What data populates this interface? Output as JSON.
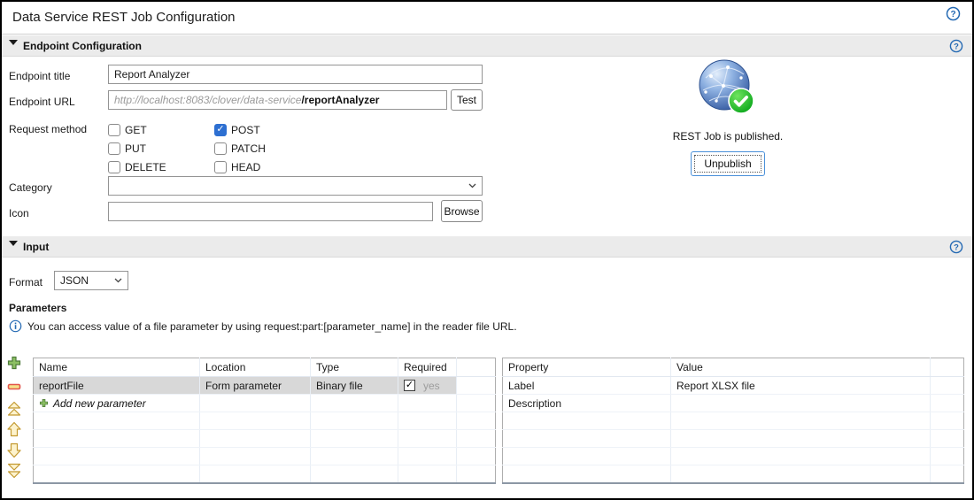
{
  "window": {
    "title": "Data Service REST Job Configuration"
  },
  "sections": {
    "endpoint_config": {
      "label": "Endpoint Configuration"
    },
    "input": {
      "label": "Input"
    }
  },
  "endpoint": {
    "title_field": {
      "label": "Endpoint title",
      "value": "Report Analyzer"
    },
    "url_field": {
      "label": "Endpoint URL",
      "base": "http://localhost:8083/clover/data-service",
      "path": "/reportAnalyzer"
    },
    "test_button": "Test",
    "request_method": {
      "label": "Request method",
      "options": [
        {
          "label": "GET",
          "checked": false
        },
        {
          "label": "POST",
          "checked": true
        },
        {
          "label": "PUT",
          "checked": false
        },
        {
          "label": "PATCH",
          "checked": false
        },
        {
          "label": "DELETE",
          "checked": false
        },
        {
          "label": "HEAD",
          "checked": false
        }
      ]
    },
    "category_field": {
      "label": "Category",
      "value": ""
    },
    "icon_field": {
      "label": "Icon",
      "value": "",
      "placeholder": ""
    },
    "browse_button": "Browse"
  },
  "publish": {
    "status": "REST Job is published.",
    "action": "Unpublish"
  },
  "input": {
    "format": {
      "label": "Format",
      "value": "JSON"
    },
    "parameters_heading": "Parameters",
    "info": "You can access value of a file parameter by using request:part:[parameter_name] in the reader file URL."
  },
  "parameters_table": {
    "headers": [
      "Name",
      "Location",
      "Type",
      "Required"
    ],
    "rows": [
      {
        "name": "reportFile",
        "location": "Form parameter",
        "type": "Binary file",
        "required": true,
        "required_label": "yes"
      }
    ],
    "add_label": "Add new parameter"
  },
  "properties_table": {
    "headers": [
      "Property",
      "Value"
    ],
    "rows": [
      {
        "property": "Label",
        "value": "Report XLSX file"
      },
      {
        "property": "Description",
        "value": ""
      }
    ]
  },
  "icons": {
    "help": "?",
    "info": "i",
    "collapse": "▾",
    "add": "+",
    "remove": "−",
    "move_top": "⏶⏶",
    "move_up": "⬆",
    "move_down": "⬇",
    "move_bottom": "⏷⏷",
    "published_badge": "✓"
  },
  "colors": {
    "accent_blue": "#2d6fd1",
    "help_blue": "#2469b3",
    "published_green": "#1fb41f",
    "section_header_bg": "#ebebeb",
    "selected_row_bg": "#d8d8d8"
  }
}
